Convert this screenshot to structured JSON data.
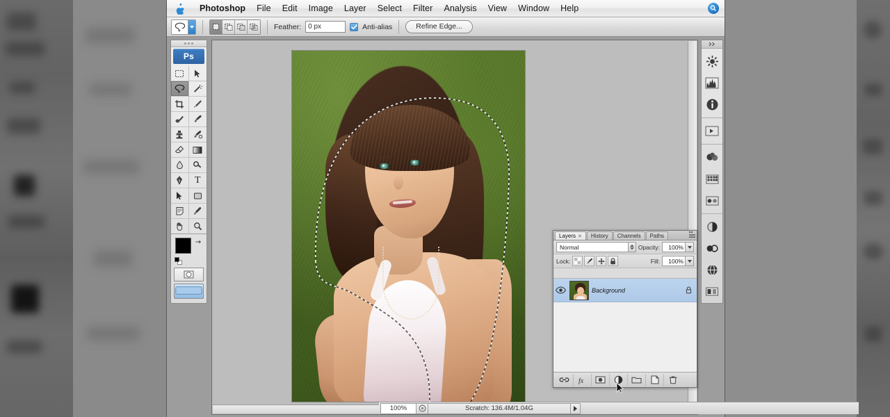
{
  "desktop": {
    "background_color": "#8d8d8d"
  },
  "menubar": {
    "apple_icon": "apple-logo-icon",
    "app_name": "Photoshop",
    "items": [
      {
        "label": "File"
      },
      {
        "label": "Edit"
      },
      {
        "label": "Image"
      },
      {
        "label": "Layer"
      },
      {
        "label": "Select"
      },
      {
        "label": "Filter"
      },
      {
        "label": "Analysis"
      },
      {
        "label": "View"
      },
      {
        "label": "Window"
      },
      {
        "label": "Help"
      }
    ],
    "spotlight_icon": "search-icon"
  },
  "options_bar": {
    "tool_icon": "lasso-tool-icon",
    "tool_preset_arrow": "chevron-down-icon",
    "selection_modes": [
      {
        "name": "new-selection",
        "icon": "square-icon",
        "active": true
      },
      {
        "name": "add-to-selection",
        "icon": "square-plus-icon",
        "active": false
      },
      {
        "name": "subtract-from-selection",
        "icon": "square-minus-icon",
        "active": false
      },
      {
        "name": "intersect-with-selection",
        "icon": "square-intersect-icon",
        "active": false
      }
    ],
    "feather_label": "Feather:",
    "feather_value": "0 px",
    "antialias_label": "Anti-alias",
    "antialias_checked": true,
    "refine_edge_label": "Refine Edge..."
  },
  "toolbox": {
    "logo": "Ps",
    "tools": [
      {
        "name": "marquee-tool",
        "icon": "marquee-icon",
        "selected": false
      },
      {
        "name": "move-tool",
        "icon": "move-arrow-icon",
        "selected": false
      },
      {
        "name": "lasso-tool",
        "icon": "lasso-icon",
        "selected": true
      },
      {
        "name": "magic-wand-tool",
        "icon": "magic-wand-icon",
        "selected": false
      },
      {
        "name": "crop-tool",
        "icon": "crop-icon",
        "selected": false
      },
      {
        "name": "slice-tool",
        "icon": "slice-knife-icon",
        "selected": false
      },
      {
        "name": "healing-brush-tool",
        "icon": "healing-brush-icon",
        "selected": false
      },
      {
        "name": "brush-tool",
        "icon": "paintbrush-icon",
        "selected": false
      },
      {
        "name": "clone-stamp-tool",
        "icon": "clone-stamp-icon",
        "selected": false
      },
      {
        "name": "history-brush-tool",
        "icon": "history-brush-icon",
        "selected": false
      },
      {
        "name": "eraser-tool",
        "icon": "eraser-icon",
        "selected": false
      },
      {
        "name": "gradient-tool",
        "icon": "gradient-icon",
        "selected": false
      },
      {
        "name": "blur-tool",
        "icon": "blur-drop-icon",
        "selected": false
      },
      {
        "name": "dodge-tool",
        "icon": "dodge-icon",
        "selected": false
      },
      {
        "name": "pen-tool",
        "icon": "pen-icon",
        "selected": false
      },
      {
        "name": "type-tool",
        "icon": "text-T-icon",
        "selected": false
      },
      {
        "name": "path-selection-tool",
        "icon": "path-arrow-icon",
        "selected": false
      },
      {
        "name": "shape-tool",
        "icon": "rectangle-shape-icon",
        "selected": false
      },
      {
        "name": "notes-tool",
        "icon": "note-icon",
        "selected": false
      },
      {
        "name": "eyedropper-tool",
        "icon": "eyedropper-icon",
        "selected": false
      },
      {
        "name": "hand-tool",
        "icon": "hand-icon",
        "selected": false
      },
      {
        "name": "zoom-tool",
        "icon": "magnifier-icon",
        "selected": false
      }
    ],
    "foreground_color": "#000000",
    "background_color": "#ffffff",
    "quick_mask_icons": [
      "standard-mode-icon",
      "quick-mask-mode-icon"
    ],
    "screen_mode_icon": "screen-mode-icon"
  },
  "document": {
    "canvas_background": "#bdbdbd",
    "selection": "marching-ants-lasso-selection",
    "photo_alt": "woman-on-grass-photo"
  },
  "status_bar": {
    "zoom_level": "100%",
    "preview_icon": "document-preview-icon",
    "info_text": "Scratch: 136.4M/1.04G",
    "arrow_icon": "play-triangle-icon"
  },
  "layers_panel": {
    "tabs": [
      {
        "label": "Layers",
        "active": true,
        "closable": true
      },
      {
        "label": "History",
        "active": false,
        "closable": false
      },
      {
        "label": "Channels",
        "active": false,
        "closable": false
      },
      {
        "label": "Paths",
        "active": false,
        "closable": false
      }
    ],
    "menu_icon": "panel-menu-icon",
    "blend_mode": "Normal",
    "opacity_label": "Opacity:",
    "opacity_value": "100%",
    "lock_label": "Lock:",
    "lock_buttons": [
      {
        "name": "lock-transparent-pixels",
        "icon": "checker-square-icon"
      },
      {
        "name": "lock-image-pixels",
        "icon": "paintbrush-small-icon"
      },
      {
        "name": "lock-position",
        "icon": "move-cross-icon"
      },
      {
        "name": "lock-all",
        "icon": "padlock-icon"
      }
    ],
    "fill_label": "Fill:",
    "fill_value": "100%",
    "layers": [
      {
        "name": "Background",
        "visible": true,
        "selected": true,
        "locked": true,
        "eye_icon": "eye-icon",
        "lock_icon": "padlock-icon",
        "thumbnail": "background-layer-thumbnail"
      }
    ],
    "footer_buttons": [
      {
        "name": "link-layers-button",
        "icon": "link-icon"
      },
      {
        "name": "layer-style-button",
        "icon": "fx-icon"
      },
      {
        "name": "layer-mask-button",
        "icon": "mask-rectangle-icon"
      },
      {
        "name": "adjustment-layer-button",
        "icon": "half-circle-icon"
      },
      {
        "name": "new-group-button",
        "icon": "folder-icon"
      },
      {
        "name": "new-layer-button",
        "icon": "new-page-icon"
      },
      {
        "name": "delete-layer-button",
        "icon": "trash-icon"
      }
    ]
  },
  "right_dock": {
    "collapse_icon": "double-chevron-icon",
    "buttons": [
      {
        "name": "brush-panel-button",
        "icon": "brush-settings-icon"
      },
      {
        "name": "histogram-panel-button",
        "icon": "histogram-icon"
      },
      {
        "name": "info-panel-button",
        "icon": "info-circle-icon"
      },
      {
        "name": "animation-panel-button",
        "icon": "animation-frames-icon"
      },
      {
        "name": "color-panel-button",
        "icon": "color-wheel-icon"
      },
      {
        "name": "swatches-panel-button",
        "icon": "swatches-grid-icon"
      },
      {
        "name": "styles-panel-button",
        "icon": "styles-icon"
      },
      {
        "name": "adjustments-panel-button",
        "icon": "adjustments-icon"
      },
      {
        "name": "masks-panel-button",
        "icon": "masks-icon"
      },
      {
        "name": "character-panel-button",
        "icon": "character-icon"
      },
      {
        "name": "layer-comps-panel-button",
        "icon": "layer-comps-icon"
      }
    ]
  }
}
